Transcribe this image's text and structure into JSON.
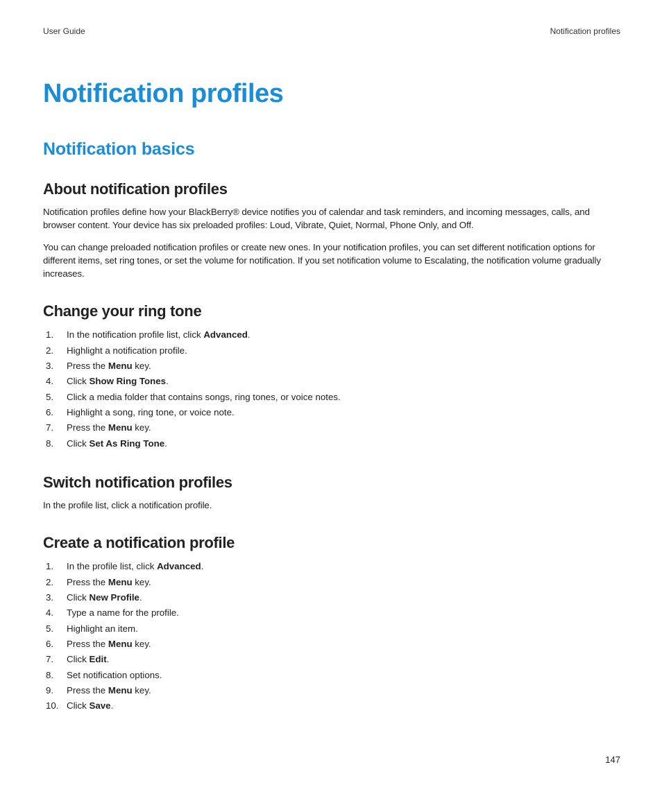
{
  "header": {
    "left": "User Guide",
    "right": "Notification profiles"
  },
  "title": "Notification profiles",
  "section_title": "Notification basics",
  "about": {
    "heading": "About notification profiles",
    "p1": "Notification profiles define how your BlackBerry® device notifies you of calendar and task reminders, and incoming messages, calls, and browser content. Your device has six preloaded profiles: Loud, Vibrate, Quiet, Normal, Phone Only, and Off.",
    "p2": "You can change preloaded notification profiles or create new ones. In your notification profiles, you can set different notification options for different items, set ring tones, or set the volume for notification. If you set notification volume to Escalating, the notification volume gradually increases."
  },
  "change": {
    "heading": "Change your ring tone",
    "s1a": "In the notification profile list, click ",
    "s1b": "Advanced",
    "s1c": ".",
    "s2": "Highlight a notification profile.",
    "s3a": "Press the ",
    "s3b": "Menu",
    "s3c": " key.",
    "s4a": "Click ",
    "s4b": "Show Ring Tones",
    "s4c": ".",
    "s5": "Click a media folder that contains songs, ring tones, or voice notes.",
    "s6": "Highlight a song, ring tone, or voice note.",
    "s7a": "Press the ",
    "s7b": "Menu",
    "s7c": " key.",
    "s8a": "Click ",
    "s8b": "Set As Ring Tone",
    "s8c": "."
  },
  "switch": {
    "heading": "Switch notification profiles",
    "p": "In the profile list, click a notification profile."
  },
  "create": {
    "heading": "Create a notification profile",
    "s1a": "In the profile list, click ",
    "s1b": "Advanced",
    "s1c": ".",
    "s2a": "Press the ",
    "s2b": "Menu",
    "s2c": " key.",
    "s3a": "Click ",
    "s3b": "New Profile",
    "s3c": ".",
    "s4": "Type a name for the profile.",
    "s5": "Highlight an item.",
    "s6a": "Press the ",
    "s6b": "Menu",
    "s6c": " key.",
    "s7a": "Click ",
    "s7b": "Edit",
    "s7c": ".",
    "s8": "Set notification options.",
    "s9a": "Press the ",
    "s9b": "Menu",
    "s9c": " key.",
    "s10a": "Click ",
    "s10b": "Save",
    "s10c": "."
  },
  "page_number": "147"
}
